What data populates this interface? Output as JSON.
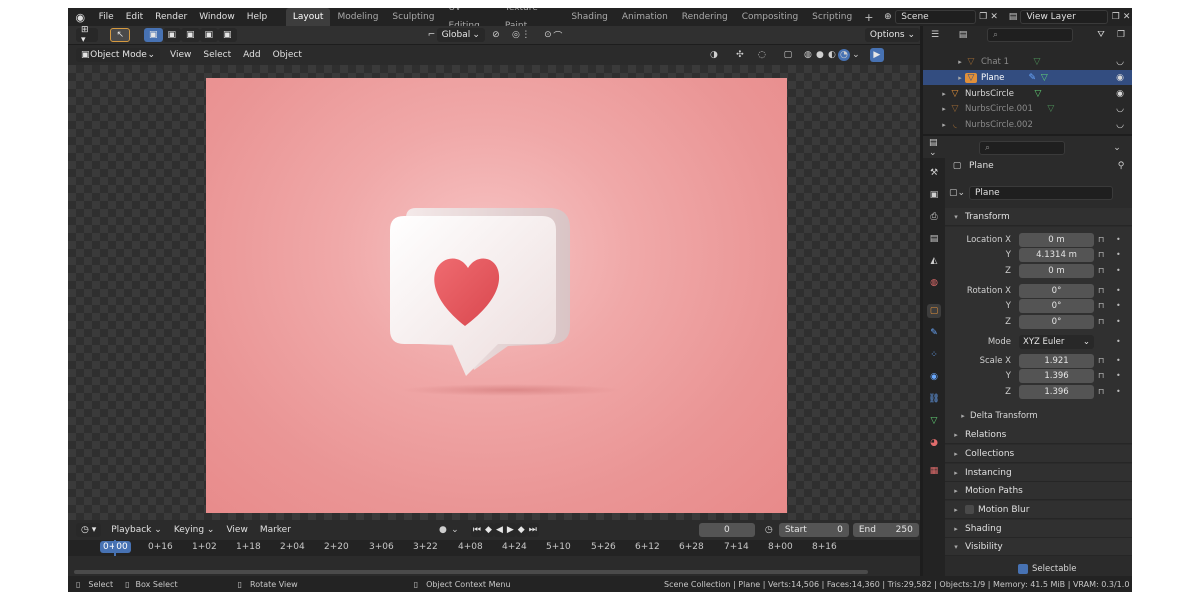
{
  "topbar": {
    "menus": [
      "File",
      "Edit",
      "Render",
      "Window",
      "Help"
    ],
    "workspaces": [
      "Layout",
      "Modeling",
      "Sculpting",
      "UV Editing",
      "Texture Paint",
      "Shading",
      "Animation",
      "Rendering",
      "Compositing",
      "Scripting"
    ],
    "active_workspace": "Layout",
    "scene": "Scene",
    "view_layer": "View Layer"
  },
  "viewport_toolbar": {
    "orientation": "Global",
    "options_label": "Options"
  },
  "viewport_header": {
    "mode": "Object Mode",
    "menus": [
      "View",
      "Select",
      "Add",
      "Object"
    ]
  },
  "outliner": {
    "items": [
      {
        "name": "Chat 1",
        "dimmed": true
      },
      {
        "name": "Plane",
        "selected": true
      },
      {
        "name": "NurbsCircle",
        "dimmed": false
      },
      {
        "name": "NurbsCircle.001",
        "dimmed": true
      },
      {
        "name": "NurbsCircle.002",
        "dimmed": true
      }
    ]
  },
  "properties": {
    "object_name": "Plane",
    "data_name": "Plane",
    "transform_label": "Transform",
    "location_label": "Location X",
    "rotation_label": "Rotation X",
    "scale_label": "Scale X",
    "axis_y": "Y",
    "axis_z": "Z",
    "location": {
      "x": "0 m",
      "y": "4.1314 m",
      "z": "0 m"
    },
    "rotation": {
      "x": "0°",
      "y": "0°",
      "z": "0°"
    },
    "mode_label": "Mode",
    "rotation_mode": "XYZ Euler",
    "scale": {
      "x": "1.921",
      "y": "1.396",
      "z": "1.396"
    },
    "delta_transform": "Delta Transform",
    "sections": [
      "Relations",
      "Collections",
      "Instancing",
      "Motion Paths",
      "Motion Blur",
      "Shading",
      "Visibility"
    ],
    "selectable_label": "Selectable"
  },
  "timeline": {
    "menus": [
      "Playback",
      "Keying",
      "View",
      "Marker"
    ],
    "current_frame": "0",
    "start_label": "Start",
    "start": "0",
    "end_label": "End",
    "end": "250",
    "ruler": [
      "0+00",
      "0+16",
      "1+02",
      "1+18",
      "2+04",
      "2+20",
      "3+06",
      "3+22",
      "4+08",
      "4+24",
      "5+10",
      "5+26",
      "6+12",
      "6+28",
      "7+14",
      "8+00",
      "8+16"
    ]
  },
  "statusbar": {
    "select": "Select",
    "box_select": "Box Select",
    "rotate_view": "Rotate View",
    "context_menu": "Object Context Menu",
    "stats": "Scene Collection | Plane | Verts:14,506 | Faces:14,360 | Tris:29,582 | Objects:1/9 | Memory: 41.5 MiB | VRAM: 0.3/1.0 GiB"
  },
  "colors": {
    "accent": "#4772b3",
    "background_pink": "#ee9b9b",
    "heart": "#e85a60"
  }
}
